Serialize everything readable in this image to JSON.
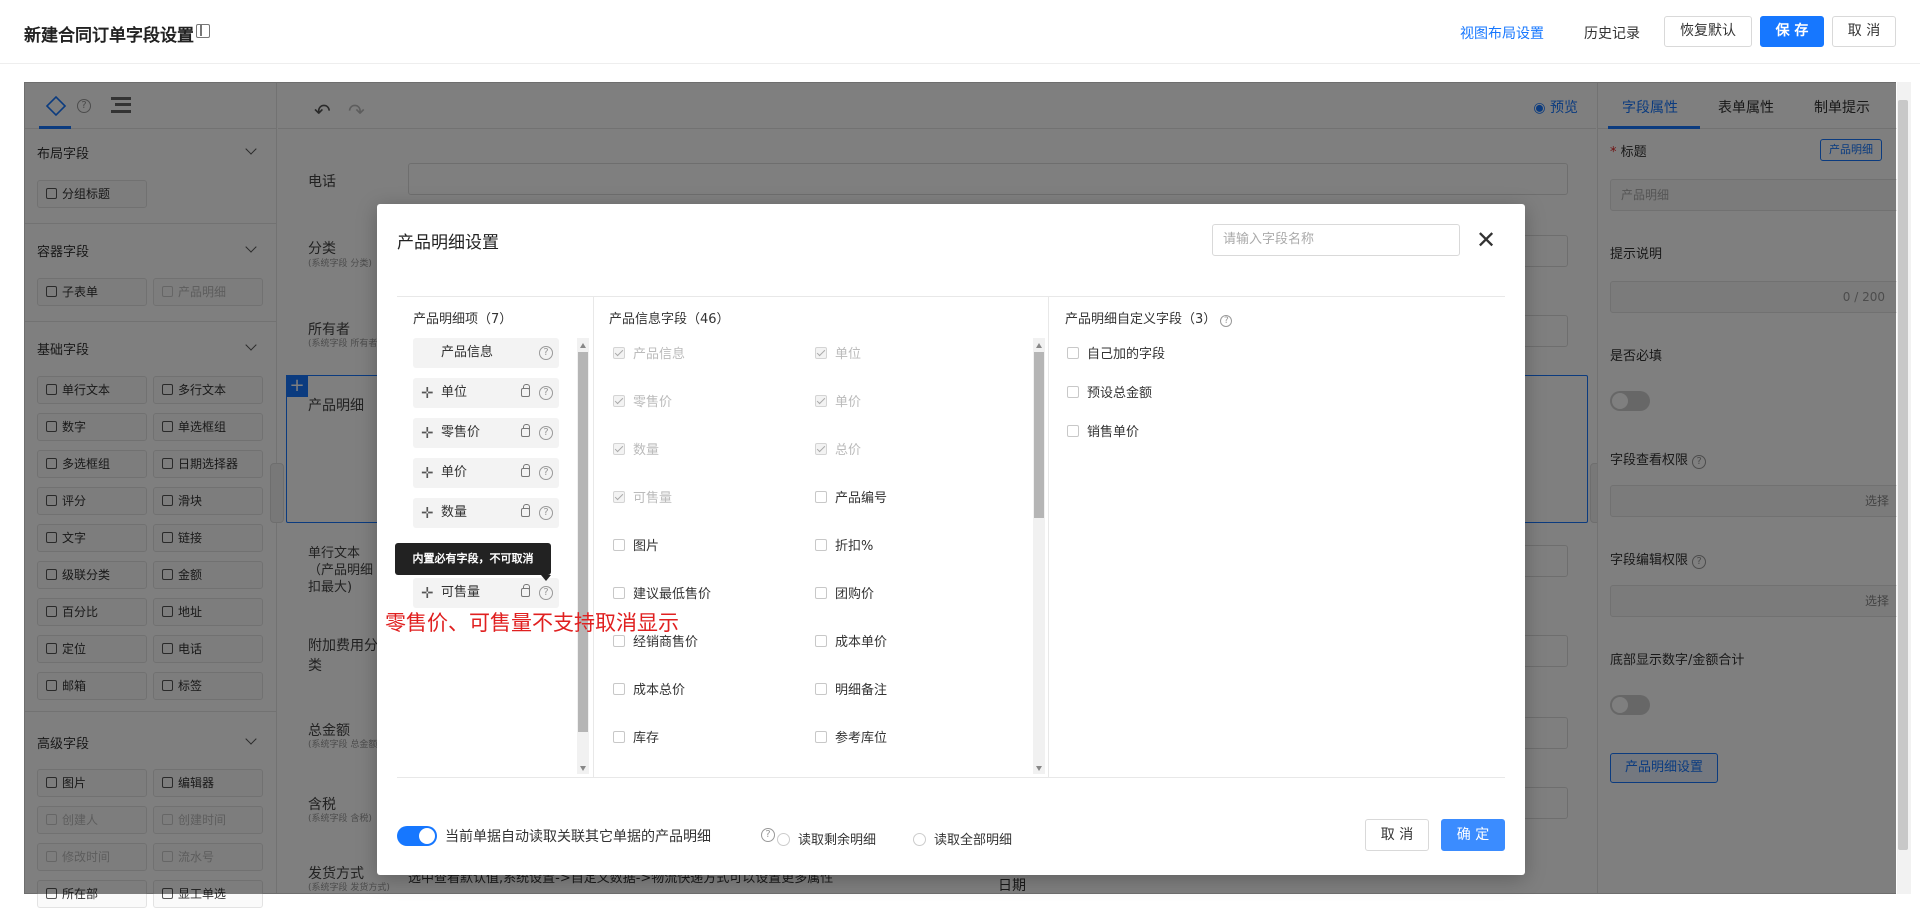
{
  "header": {
    "title": "新建合同订单字段设置",
    "view_layout": "视图布局设置",
    "history": "历史记录",
    "restore": "恢复默认",
    "save": "保 存",
    "cancel": "取 消"
  },
  "left_panel": {
    "sections": [
      {
        "title": "布局字段",
        "items": [
          "分组标题"
        ]
      },
      {
        "title": "容器字段",
        "items": [
          "子表单",
          "产品明细"
        ]
      },
      {
        "title": "基础字段",
        "items": [
          "单行文本",
          "多行文本",
          "数字",
          "单选框组",
          "多选框组",
          "日期选择器",
          "评分",
          "滑块",
          "文字",
          "链接",
          "级联分类",
          "金额",
          "百分比",
          "地址",
          "定位",
          "电话",
          "邮箱",
          "标签"
        ]
      },
      {
        "title": "高级字段",
        "items": [
          "图片",
          "编辑器",
          "创建人",
          "创建时间",
          "修改时间",
          "流水号",
          "所在部",
          "显工单选"
        ]
      }
    ]
  },
  "canvas": {
    "preview": "预览",
    "rows": [
      {
        "label": "电话",
        "sub": ""
      },
      {
        "label": "分类",
        "sub": "(系统字段 分类)"
      },
      {
        "label": "所有者",
        "sub": "(系统字段 所有者)"
      },
      {
        "label": "产品明细",
        "sub": ""
      },
      {
        "label": "单行文本（产品明细扣最大)",
        "sub": ""
      },
      {
        "label": "附加费用分类",
        "sub": "(系统字段 附加费用)"
      },
      {
        "label": "总金额",
        "sub": "(系统字段 总金额)"
      },
      {
        "label": "含税",
        "sub": "(系统字段 含税)"
      },
      {
        "label": "发货方式",
        "sub": "(系统字段 发货方式)"
      }
    ],
    "bottom_hint": "选中查看默认值,系统设置->自定义数据->物流快递方式可以设置更多属性",
    "date_label": "日期"
  },
  "right_panel": {
    "tabs": [
      "字段属性",
      "表单属性",
      "制单提示"
    ],
    "title_label": "标题",
    "badge": "产品明细",
    "title_value": "产品明细",
    "hint_label": "提示说明",
    "hint_counter": "0 / 200",
    "required_label": "是否必填",
    "view_perm_label": "字段查看权限",
    "edit_perm_label": "字段编辑权限",
    "select_text": "选择",
    "bottom_sum_label": "底部显示数字/金额合计",
    "product_setting_button": "产品明细设置"
  },
  "modal": {
    "title": "产品明细设置",
    "search_placeholder": "请输入字段名称",
    "col1": {
      "title": "产品明细项（7）",
      "items": [
        "产品信息",
        "单位",
        "零售价",
        "单价",
        "数量",
        "可售量"
      ]
    },
    "tooltip": "内置必有字段，不可取消",
    "annotation": "零售价、可售量不支持取消显示",
    "col2": {
      "title": "产品信息字段（46）",
      "left": [
        {
          "label": "产品信息",
          "checked": true
        },
        {
          "label": "零售价",
          "checked": true
        },
        {
          "label": "数量",
          "checked": true
        },
        {
          "label": "可售量",
          "checked": true
        },
        {
          "label": "图片",
          "checked": false
        },
        {
          "label": "建议最低售价",
          "checked": false
        },
        {
          "label": "经销商售价",
          "checked": false
        },
        {
          "label": "成本总价",
          "checked": false
        },
        {
          "label": "库存",
          "checked": false
        }
      ],
      "right": [
        {
          "label": "单位",
          "checked": true
        },
        {
          "label": "单价",
          "checked": true
        },
        {
          "label": "总价",
          "checked": true
        },
        {
          "label": "产品编号",
          "checked": false
        },
        {
          "label": "折扣%",
          "checked": false
        },
        {
          "label": "团购价",
          "checked": false
        },
        {
          "label": "成本单价",
          "checked": false
        },
        {
          "label": "明细备注",
          "checked": false
        },
        {
          "label": "参考库位",
          "checked": false
        }
      ]
    },
    "col3": {
      "title": "产品明细自定义字段（3）",
      "items": [
        "自己加的字段",
        "预设总金额",
        "销售单价"
      ]
    },
    "footer": {
      "auto_read": "当前单据自动读取关联其它单据的产品明细",
      "radio1": "读取剩余明细",
      "radio2": "读取全部明细",
      "cancel": "取 消",
      "ok": "确 定"
    }
  }
}
